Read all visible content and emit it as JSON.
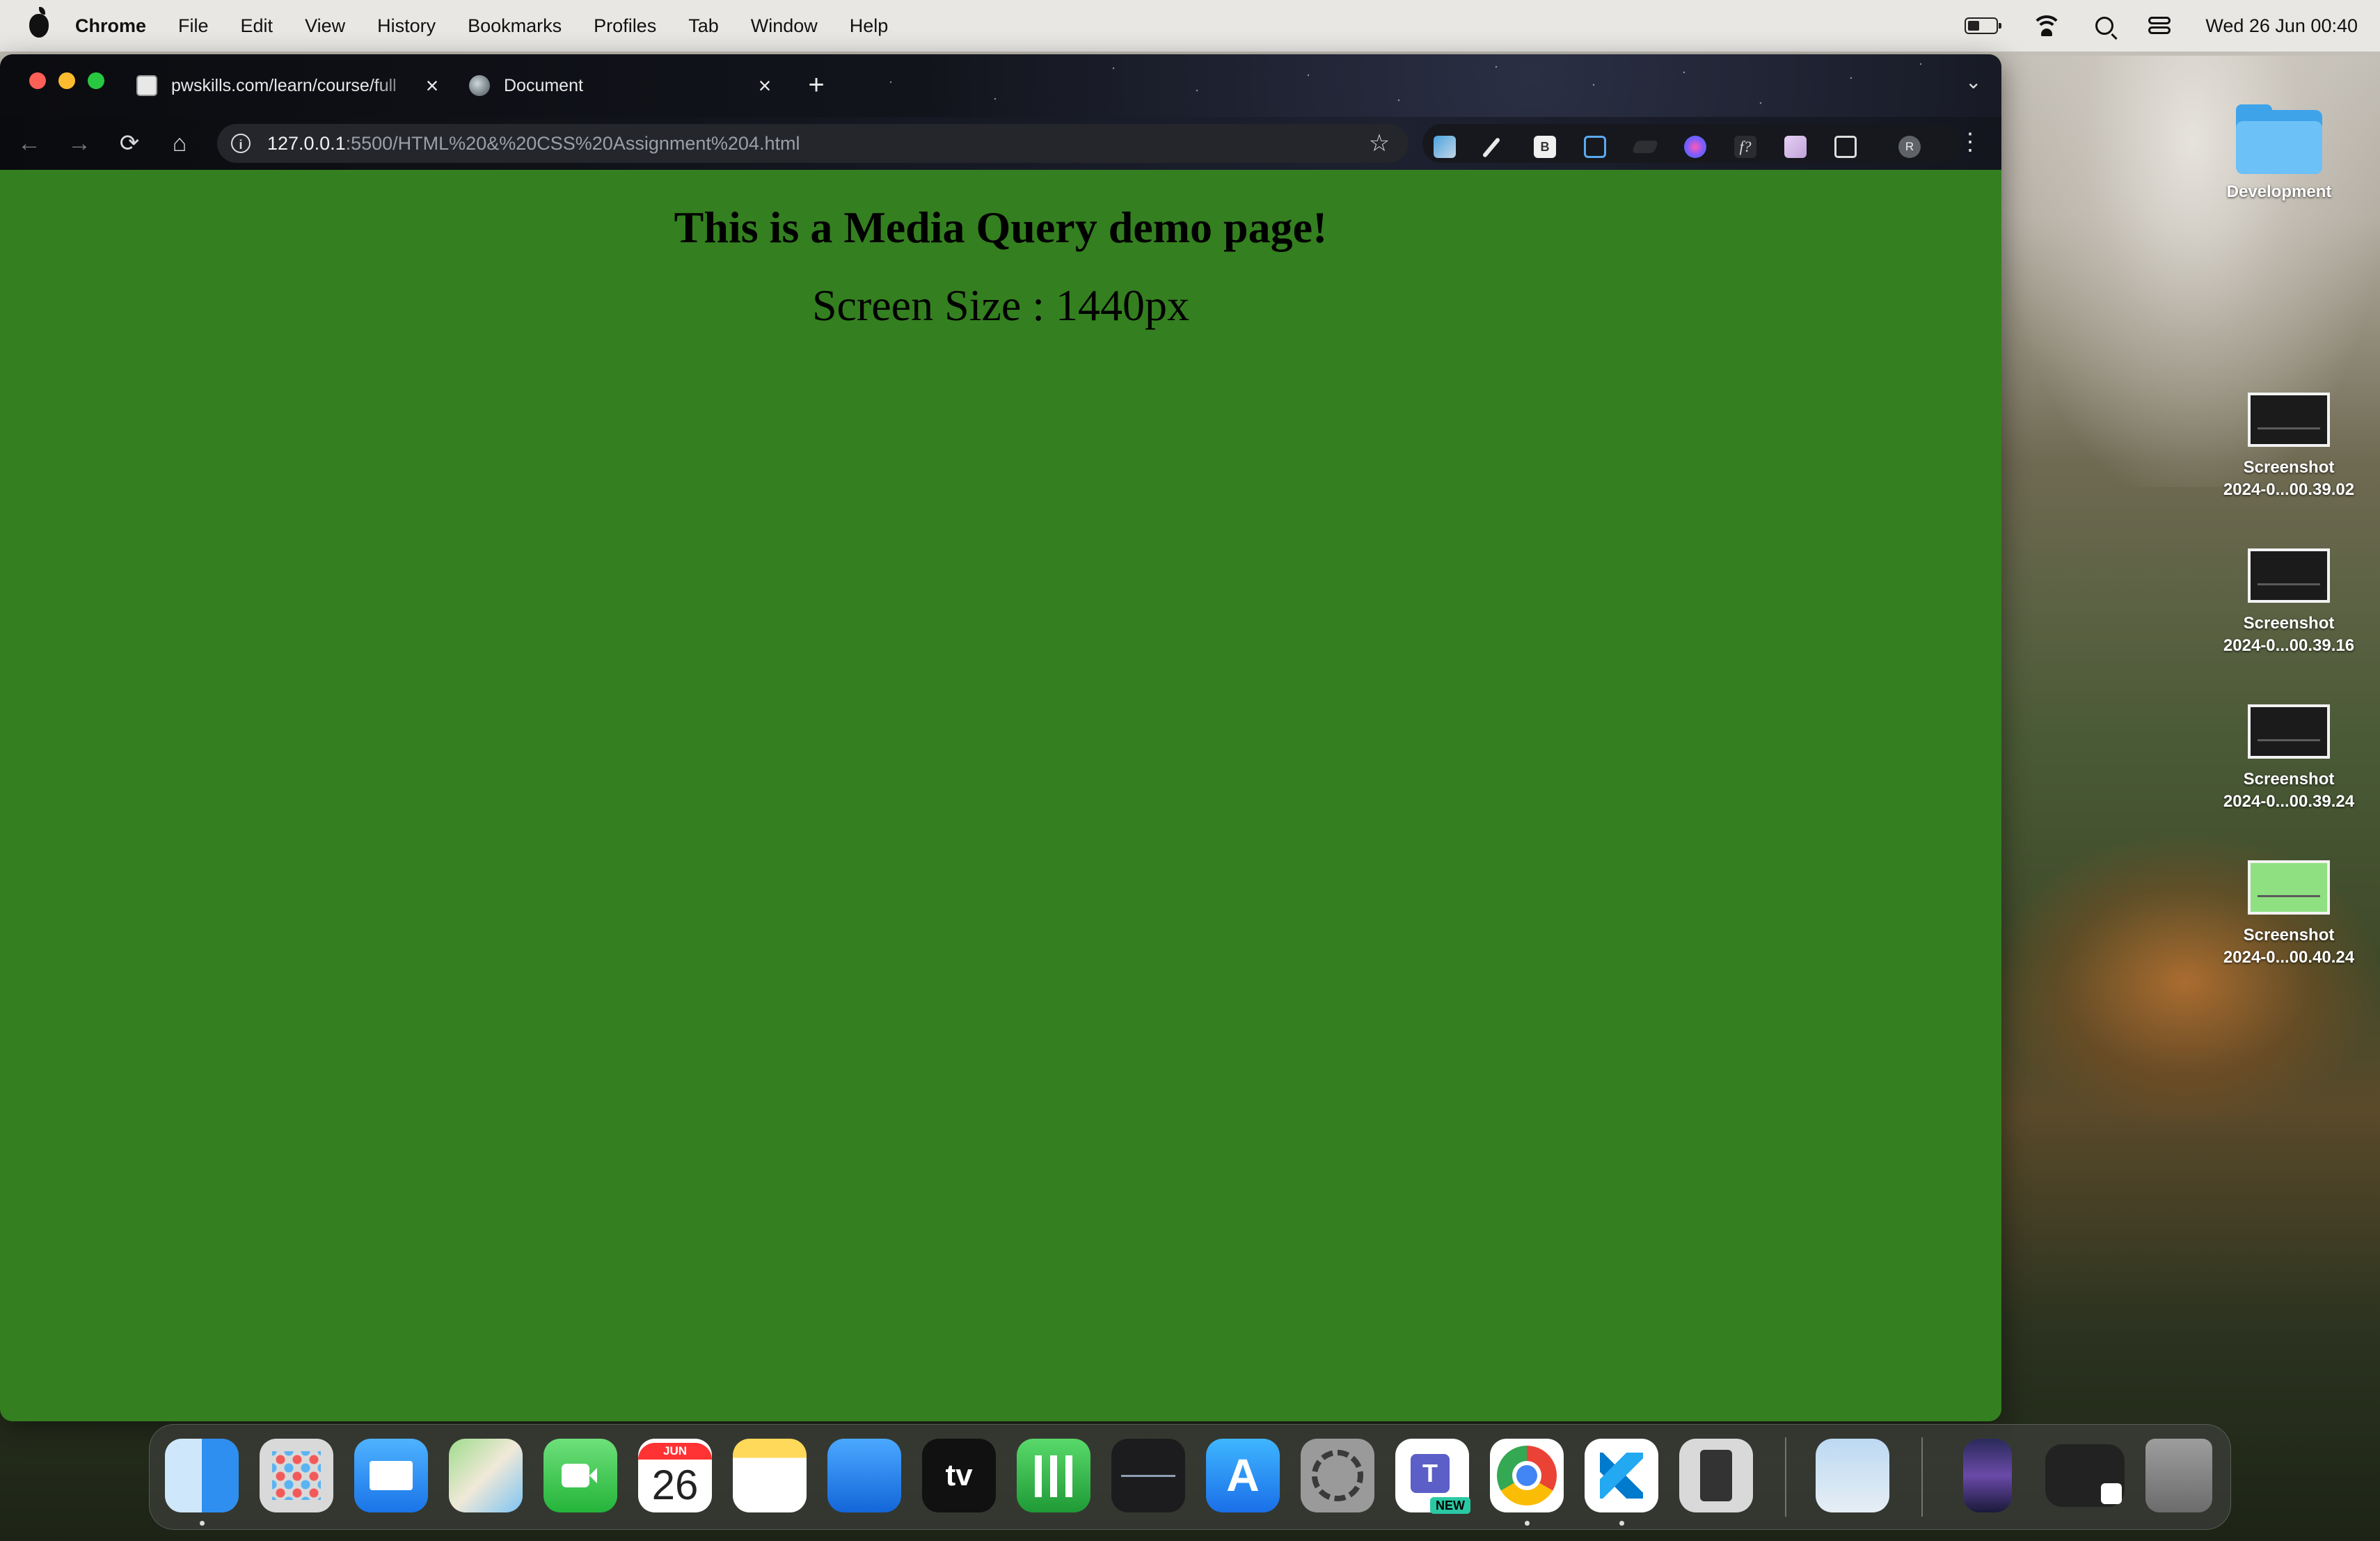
{
  "menubar": {
    "app_name": "Chrome",
    "menus": [
      "File",
      "Edit",
      "View",
      "History",
      "Bookmarks",
      "Profiles",
      "Tab",
      "Window",
      "Help"
    ],
    "datetime": "Wed 26 Jun  00:40"
  },
  "browser": {
    "tabs": [
      {
        "title": "pwskills.com/learn/course/full",
        "icon": "pwskills-favicon"
      },
      {
        "title": "Document",
        "icon": "globe-icon"
      }
    ],
    "url": {
      "host": "127.0.0.1",
      "path": ":5500/HTML%20&%20CSS%20Assignment%204.html"
    },
    "profile_initial": "R",
    "extension_labels": {
      "b": "B",
      "f": "f?"
    },
    "nav_icons": {
      "back": "←",
      "forward": "→",
      "reload": "⟳",
      "home": "⌂",
      "star": "☆",
      "new_tab": "+",
      "close": "×",
      "menu": "⋮",
      "tab_menu": "⌄"
    }
  },
  "page": {
    "heading": "This is a Media Query demo page!",
    "screen_size_text": "Screen Size : 1440px",
    "background_color": "#347f20"
  },
  "desktop": {
    "folder": {
      "label": "Development"
    },
    "screenshots": [
      {
        "line1": "Screenshot",
        "line2": "2024-0...00.39.02"
      },
      {
        "line1": "Screenshot",
        "line2": "2024-0...00.39.16"
      },
      {
        "line1": "Screenshot",
        "line2": "2024-0...00.39.24"
      },
      {
        "line1": "Screenshot",
        "line2": "2024-0...00.40.24"
      }
    ]
  },
  "dock": {
    "calendar": {
      "month": "JUN",
      "day": "26"
    },
    "tv_label": "tv",
    "teams_badge": "NEW",
    "teams_letter": "T",
    "appstore_glyph": "A"
  }
}
